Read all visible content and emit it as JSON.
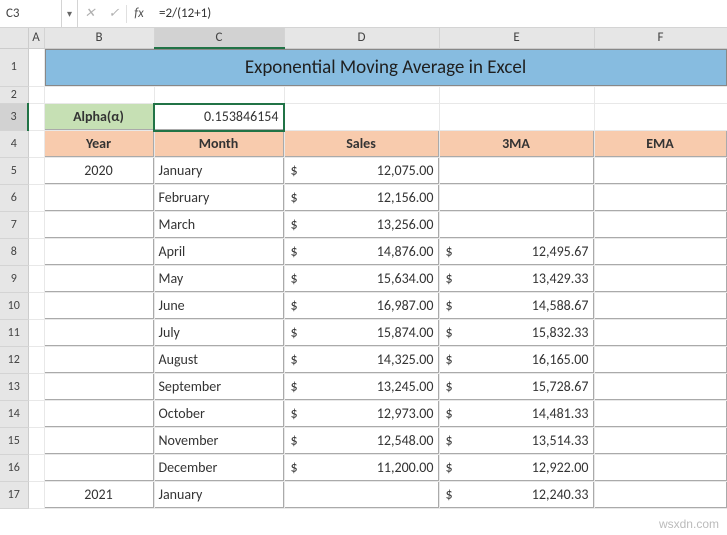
{
  "namebox": "C3",
  "formula": "=2/(12+1)",
  "columns": [
    "A",
    "B",
    "C",
    "D",
    "E",
    "F"
  ],
  "activeCol": "C",
  "activeRow": 3,
  "title": "Exponential Moving Average in Excel",
  "alphaLabel": "Alpha(α)",
  "alphaValue": "0.153846154",
  "headers": {
    "year": "Year",
    "month": "Month",
    "sales": "Sales",
    "ma3": "3MA",
    "ema": "EMA"
  },
  "rows": [
    {
      "year": "2020",
      "month": "January",
      "sales": "12,075.00",
      "ma3": "",
      "ema": ""
    },
    {
      "year": "",
      "month": "February",
      "sales": "12,156.00",
      "ma3": "",
      "ema": ""
    },
    {
      "year": "",
      "month": "March",
      "sales": "13,256.00",
      "ma3": "",
      "ema": ""
    },
    {
      "year": "",
      "month": "April",
      "sales": "14,876.00",
      "ma3": "12,495.67",
      "ema": ""
    },
    {
      "year": "",
      "month": "May",
      "sales": "15,634.00",
      "ma3": "13,429.33",
      "ema": ""
    },
    {
      "year": "",
      "month": "June",
      "sales": "16,987.00",
      "ma3": "14,588.67",
      "ema": ""
    },
    {
      "year": "",
      "month": "July",
      "sales": "15,874.00",
      "ma3": "15,832.33",
      "ema": ""
    },
    {
      "year": "",
      "month": "August",
      "sales": "14,325.00",
      "ma3": "16,165.00",
      "ema": ""
    },
    {
      "year": "",
      "month": "September",
      "sales": "13,245.00",
      "ma3": "15,728.67",
      "ema": ""
    },
    {
      "year": "",
      "month": "October",
      "sales": "12,973.00",
      "ma3": "14,481.33",
      "ema": ""
    },
    {
      "year": "",
      "month": "November",
      "sales": "12,548.00",
      "ma3": "13,514.33",
      "ema": ""
    },
    {
      "year": "",
      "month": "December",
      "sales": "11,200.00",
      "ma3": "12,922.00",
      "ema": ""
    },
    {
      "year": "2021",
      "month": "January",
      "sales": "",
      "ma3": "12,240.33",
      "ema": ""
    }
  ],
  "currency": "$",
  "watermark": "wsxdn.com"
}
